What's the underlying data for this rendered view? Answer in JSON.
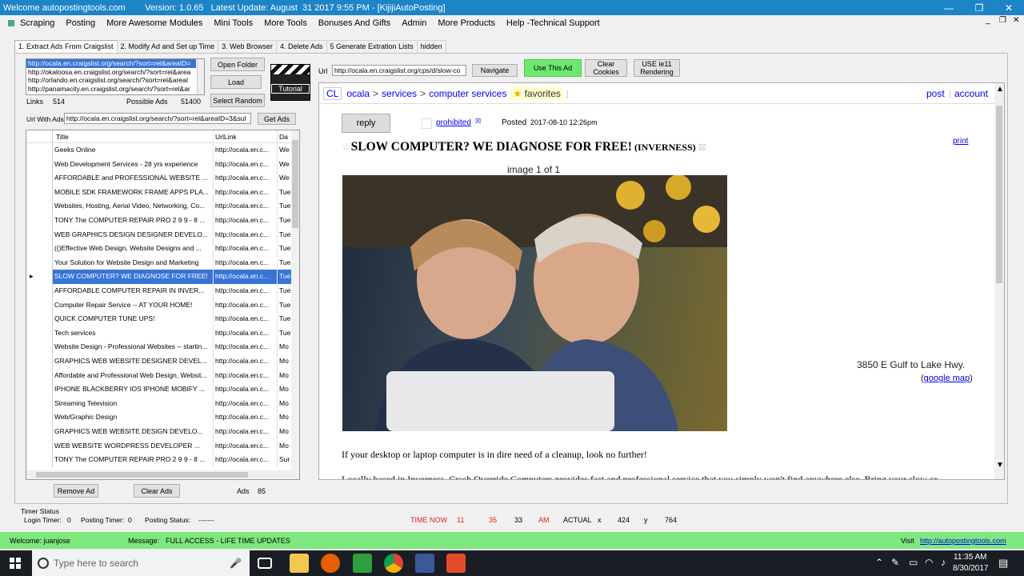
{
  "window": {
    "title": "Welcome autopostingtools.com        Version: 1.0.65   Latest Update: August  31 2017 9:55 PM - [KijijiAutoPosting]",
    "minimize_glyph": "—",
    "maximize_glyph": "❐",
    "close_glyph": "✕"
  },
  "menu": [
    "Scraping",
    "Posting",
    "More Awesome Modules",
    "Mini Tools",
    "More Tools",
    "Bonuses And Gifts",
    "Admin",
    "More Products",
    "Help -Technical Support"
  ],
  "mdi_controls": {
    "min": "_",
    "restore": "❐",
    "close": "✕"
  },
  "tabs": [
    "1. Extract Ads From Craigslist",
    "2. Modify Ad and Set up Time",
    "3. Web Browser",
    "4. Delete Ads",
    "5 Generate Extration Lists",
    "hidden"
  ],
  "url_list": [
    "http://ocala.en.craigslist.org/search/?sort=rel&areaID=",
    "http://okaloosa.en.craigslist.org/search/?sort=rel&area",
    "http://orlando.en.craigslist.org/search/?sort=rel&areaI",
    "http://panamacity.en.craigslist.org/search/?sort=rel&ar"
  ],
  "buttons": {
    "open_folder": "Open Folder",
    "load": "Load",
    "select_random": "Select Random",
    "tutorial": "Tutorial",
    "get_ads": "Get Ads",
    "navigate": "Navigate",
    "use_this_ad": "Use This Ad",
    "clear_cookies": "Clear Cookies",
    "use_ie11": "USE ie11 Rendering",
    "remove_ad": "Remove Ad",
    "clear_ads": "Clear Ads"
  },
  "stats": {
    "links_label": "Links",
    "links_value": "514",
    "possible_ads_label": "Possible Ads",
    "possible_ads_value": "51400",
    "ads_label": "Ads",
    "ads_value": "85"
  },
  "url_with_ads": {
    "label": "Url With Ads",
    "value": "http://ocala.en.craigslist.org/search/?sort=rel&areaID=3&sul"
  },
  "browser_url": {
    "label": "Url",
    "value": "http://ocala.en.craigslist.org/cps/d/slow-co"
  },
  "grid": {
    "columns": [
      "Title",
      "UrlLink",
      "Da"
    ],
    "rows": [
      {
        "title": "Geeks Online",
        "url": "http://ocala.en.c...",
        "d": "We"
      },
      {
        "title": "Web Development Services - 28 yrs experience",
        "url": "http://ocala.en.c...",
        "d": "We"
      },
      {
        "title": "AFFORDABLE and PROFESSIONAL WEBSITE ...",
        "url": "http://ocala.en.c...",
        "d": "We"
      },
      {
        "title": "MOBILE SDK FRAMEWORK FRAME APPS PLA...",
        "url": "http://ocala.en.c...",
        "d": "Tue"
      },
      {
        "title": "Websites, Hosting, Aerial Video, Networking, Co...",
        "url": "http://ocala.en.c...",
        "d": "Tue"
      },
      {
        "title": "TONY The COMPUTER REPAIR PRO  2 9 9 - 8 ...",
        "url": "http://ocala.en.c...",
        "d": "Tue"
      },
      {
        "title": "WEB GRAPHICS DESIGN DESIGNER DEVELO...",
        "url": "http://ocala.en.c...",
        "d": "Tue"
      },
      {
        "title": "(()Effective Web Design, Website Designs and ...",
        "url": "http://ocala.en.c...",
        "d": "Tue"
      },
      {
        "title": "Your Solution for Website Design and Marketing",
        "url": "http://ocala.en.c...",
        "d": "Tue"
      },
      {
        "title": "SLOW COMPUTER? WE DIAGNOSE FOR FREE!",
        "url": "http://ocala.en.c...",
        "d": "Tue",
        "selected": true
      },
      {
        "title": "AFFORDABLE COMPUTER REPAIR IN INVER...",
        "url": "http://ocala.en.c...",
        "d": "Tue"
      },
      {
        "title": "Computer Repair Service -- AT YOUR HOME!",
        "url": "http://ocala.en.c...",
        "d": "Tue"
      },
      {
        "title": "QUICK COMPUTER TUNE UPS!",
        "url": "http://ocala.en.c...",
        "d": "Tue"
      },
      {
        "title": "Tech services",
        "url": "http://ocala.en.c...",
        "d": "Tue"
      },
      {
        "title": "Website Design - Professional Websites -- startin...",
        "url": "http://ocala.en.c...",
        "d": "Mo"
      },
      {
        "title": "GRAPHICS WEB WEBSITE DESIGNER DEVEL...",
        "url": "http://ocala.en.c...",
        "d": "Mo"
      },
      {
        "title": "Affordable and Professional Web Design, Websit...",
        "url": "http://ocala.en.c...",
        "d": "Mo"
      },
      {
        "title": "IPHONE BLACKBERRY IOS IPHONE MOBIFY ...",
        "url": "http://ocala.en.c...",
        "d": "Mo"
      },
      {
        "title": "Streaming Television",
        "url": "http://ocala.en.c...",
        "d": "Mo"
      },
      {
        "title": "Web/Graphic Design",
        "url": "http://ocala.en.c...",
        "d": "Mo"
      },
      {
        "title": "GRAPHICS WEB  WEBSITE DESIGN  DEVELO...",
        "url": "http://ocala.en.c...",
        "d": "Mo"
      },
      {
        "title": "WEB  WEBSITE WORDPRESS DEVELOPER  ...",
        "url": "http://ocala.en.c...",
        "d": "Mo"
      },
      {
        "title": "TONY The COMPUTER REPAIR PRO  2 9 9 - 8 ...",
        "url": "http://ocala.en.c...",
        "d": "Sur"
      }
    ]
  },
  "craigslist": {
    "logo": "CL",
    "breadcrumb": [
      "ocala",
      ">",
      "services",
      ">",
      "computer services"
    ],
    "favorites": "favorites",
    "post": "post",
    "account": "account",
    "reply": "reply",
    "prohibited": "prohibited",
    "posted_label": "Posted",
    "posted_value": "2017-08-10 12:26pm",
    "print": "print",
    "title_main": "SLOW COMPUTER? WE DIAGNOSE FOR FREE!",
    "title_location": "(INVERNESS)",
    "image_counter": "image 1 of 1",
    "address": "3850 E Gulf to Lake Hwy.",
    "map_link": "google map",
    "body_line1": "If your desktop or laptop computer is in dire need of a cleanup, look no further!",
    "body_line2": "Locally based in Inverness, Crash Override Computers provides fast and professional service that you simply won't find anywhere else. Bring your slow or"
  },
  "timer": {
    "status_label": "Timer Status",
    "login_label": "Login Timer:",
    "login_value": "0",
    "posting_label": "Posting Timer:",
    "posting_value": "0",
    "posting_status_label": "Posting Status:",
    "posting_status_value": "-------",
    "time_now_label": "TIME NOW",
    "hour": "11",
    "minute": "35",
    "second": "33",
    "ampm": "AM",
    "actual_label": "ACTUAL",
    "x_label": "x",
    "x_value": "424",
    "y_label": "y",
    "y_value": "764"
  },
  "status": {
    "welcome": "Welcome: juanjose",
    "message_label": "Message:",
    "message_value": "FULL ACCESS - LIFE TIME UPDATES",
    "visit_label": "Visit",
    "visit_link": "http://autopostingtools.com"
  },
  "taskbar": {
    "search_placeholder": "Type here to search",
    "time": "11:35 AM",
    "date": "8/30/2017"
  },
  "colors": {
    "titlebar": "#1e84c8",
    "status_green": "#7ee87e",
    "accent_green": "#6fe86f",
    "selection": "#3874d8",
    "timer_red": "#e02020"
  }
}
